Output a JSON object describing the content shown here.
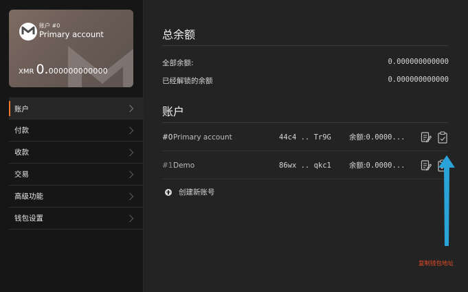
{
  "wallet_card": {
    "account_index": "账户 #0",
    "account_name": "Primary account",
    "currency": "XMR",
    "balance_int": "0.",
    "balance_dec": "000000000000"
  },
  "sidebar": {
    "items": [
      {
        "label": "账户",
        "active": true
      },
      {
        "label": "付款"
      },
      {
        "label": "收款"
      },
      {
        "label": "交易"
      },
      {
        "label": "高级功能"
      },
      {
        "label": "钱包设置"
      }
    ]
  },
  "summary": {
    "title": "总余额",
    "total_label": "全部余额:",
    "total_value": "0.000000000000",
    "unlocked_label": "已经解锁的余额",
    "unlocked_value": "0.000000000000"
  },
  "accounts": {
    "title": "账户",
    "rows": [
      {
        "index": "#0",
        "name": "Primary account",
        "address": "44c4 .. Tr9G",
        "balance_label": "余额:",
        "balance_value": "0.0000..."
      },
      {
        "index": "#1",
        "name": "Demo",
        "address": "86wx .. qkc1",
        "balance_label": "余额:",
        "balance_value": "0.0000..."
      }
    ],
    "create_label": "创建新账号"
  },
  "annotation": {
    "text": "复制钱包地址",
    "color": "#e14b2a",
    "arrow_color": "#2aa3d8"
  },
  "colors": {
    "accent": "#f0782b",
    "card": "#7d6c63",
    "background": "#232323",
    "sidebar": "#161616"
  }
}
